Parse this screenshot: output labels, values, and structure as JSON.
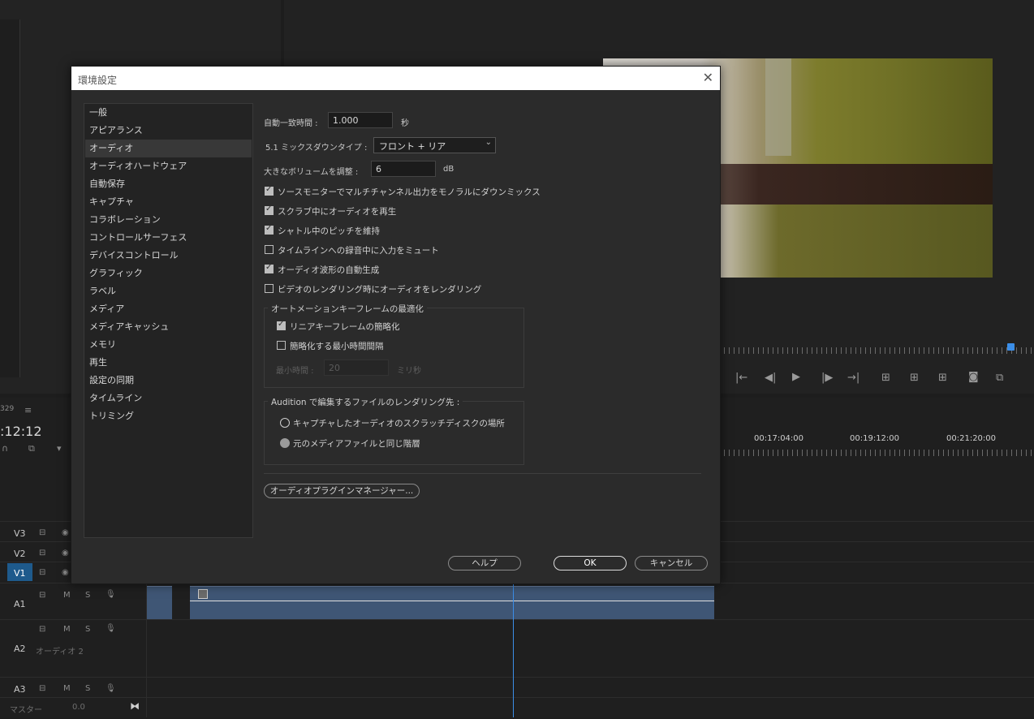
{
  "background": {
    "timecode": ":12:12",
    "frame_label": "329",
    "ruler_times": [
      "00:17:04:00",
      "00:19:12:00",
      "00:21:20:00"
    ],
    "tracks": [
      {
        "name": "V3"
      },
      {
        "name": "V2"
      },
      {
        "name": "V1"
      },
      {
        "name": "A1"
      },
      {
        "name": "A2",
        "label": "オーディオ 2"
      },
      {
        "name": "A3"
      }
    ],
    "master": {
      "label": "マスター",
      "value": "0.0"
    },
    "track_buttons": {
      "m": "M",
      "s": "S"
    }
  },
  "dialog": {
    "title": "環境設定",
    "categories": [
      "一般",
      "アピアランス",
      "オーディオ",
      "オーディオハードウェア",
      "自動保存",
      "キャプチャ",
      "コラボレーション",
      "コントロールサーフェス",
      "デバイスコントロール",
      "グラフィック",
      "ラベル",
      "メディア",
      "メディアキャッシュ",
      "メモリ",
      "再生",
      "設定の同期",
      "タイムライン",
      "トリミング"
    ],
    "selected_category": "オーディオ",
    "auto_match": {
      "label": "自動一致時間 :",
      "value": "1.000",
      "unit": "秒"
    },
    "mixdown": {
      "label": "5.1 ミックスダウンタイプ :",
      "value": "フロント + リア"
    },
    "large_volume": {
      "label": "大きなボリュームを調整 :",
      "value": "6",
      "unit": "dB"
    },
    "checkboxes": [
      {
        "label": "ソースモニターでマルチチャンネル出力をモノラルにダウンミックス",
        "checked": true
      },
      {
        "label": "スクラブ中にオーディオを再生",
        "checked": true
      },
      {
        "label": "シャトル中のピッチを維持",
        "checked": true
      },
      {
        "label": "タイムラインへの録音中に入力をミュート",
        "checked": false
      },
      {
        "label": "オーディオ波形の自動生成",
        "checked": true
      },
      {
        "label": "ビデオのレンダリング時にオーディオをレンダリング",
        "checked": false
      }
    ],
    "automation": {
      "title": "オートメーションキーフレームの最適化",
      "linear": {
        "label": "リニアキーフレームの簡略化",
        "checked": true
      },
      "min_interval": {
        "label": "簡略化する最小時間間隔",
        "checked": false
      },
      "min_time": {
        "label": "最小時間 :",
        "value": "20",
        "unit": "ミリ秒"
      }
    },
    "audition": {
      "title": "Audition で編集するファイルのレンダリング先 :",
      "options": [
        {
          "label": "キャプチャしたオーディオのスクラッチディスクの場所",
          "selected": false
        },
        {
          "label": "元のメディアファイルと同じ階層",
          "selected": true
        }
      ]
    },
    "plugin_manager_label": "オーディオプラグインマネージャー...",
    "help_label": "ヘルプ",
    "ok_label": "OK",
    "cancel_label": "キャンセル"
  }
}
